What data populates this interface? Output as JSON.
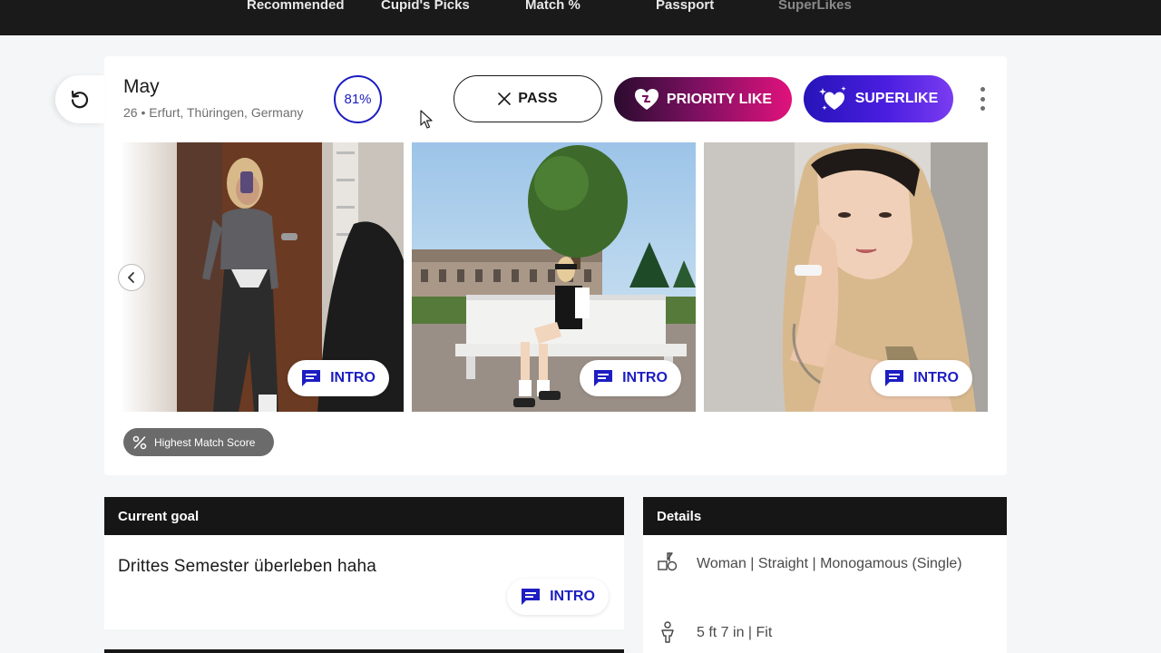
{
  "nav": {
    "tabs": [
      {
        "label": "Recommended"
      },
      {
        "label": "Cupid's Picks"
      },
      {
        "label": "Match %"
      },
      {
        "label": "Passport"
      },
      {
        "label": "SuperLikes"
      }
    ]
  },
  "profile": {
    "name": "May",
    "subline": "26 • Erfurt, Thüringen, Germany",
    "match_percent": "81%"
  },
  "actions": {
    "pass_label": "PASS",
    "priority_label": "PRIORITY LIKE",
    "superlike_label": "SUPERLIKE"
  },
  "photos": {
    "intro_label": "INTRO"
  },
  "badge": {
    "label": "Highest Match Score"
  },
  "goal": {
    "header": "Current goal",
    "text": "Drittes Semester überleben haha",
    "intro_label": "INTRO"
  },
  "details": {
    "header": "Details",
    "rows": [
      {
        "icon": "gender-icon",
        "text": "Woman | Straight | Monogamous (Single)"
      },
      {
        "icon": "body-icon",
        "text": "5 ft 7 in | Fit"
      }
    ]
  },
  "colors": {
    "accent": "#1c1dc2",
    "nav_bg": "#1a1a1a",
    "priority_gradient": [
      "#2a0b2e",
      "#e0127c"
    ],
    "superlike_gradient": [
      "#2614b8",
      "#7a3cf0"
    ]
  }
}
